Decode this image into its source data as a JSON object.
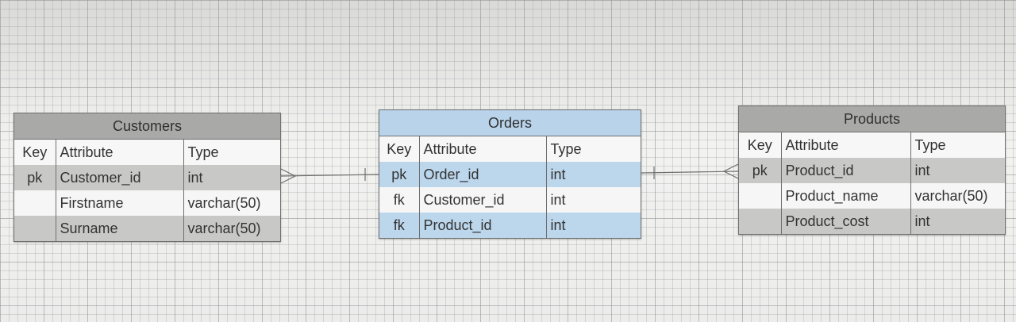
{
  "entities": [
    {
      "name": "Customers",
      "header": {
        "key": "Key",
        "attribute": "Attribute",
        "type": "Type"
      },
      "rows": [
        {
          "key": "pk",
          "attribute": "Customer_id",
          "type": "int"
        },
        {
          "key": "",
          "attribute": "Firstname",
          "type": "varchar(50)"
        },
        {
          "key": "",
          "attribute": "Surname",
          "type": "varchar(50)"
        }
      ]
    },
    {
      "name": "Orders",
      "header": {
        "key": "Key",
        "attribute": "Attribute",
        "type": "Type"
      },
      "rows": [
        {
          "key": "pk",
          "attribute": "Order_id",
          "type": "int"
        },
        {
          "key": "fk",
          "attribute": "Customer_id",
          "type": "int"
        },
        {
          "key": "fk",
          "attribute": "Product_id",
          "type": "int"
        }
      ]
    },
    {
      "name": "Products",
      "header": {
        "key": "Key",
        "attribute": "Attribute",
        "type": "Type"
      },
      "rows": [
        {
          "key": "pk",
          "attribute": "Product_id",
          "type": "int"
        },
        {
          "key": "",
          "attribute": "Product_name",
          "type": "varchar(50)"
        },
        {
          "key": "",
          "attribute": "Product_cost",
          "type": "int"
        }
      ]
    }
  ],
  "relationships": [
    {
      "from": "Customers",
      "to": "Orders",
      "from_end": "many",
      "to_end": "one"
    },
    {
      "from": "Orders",
      "to": "Products",
      "from_end": "one",
      "to_end": "many"
    }
  ],
  "colors": {
    "grey_header": "#a9a9a8",
    "blue_header": "#b9d4ea",
    "line": "#6f6f6f"
  }
}
